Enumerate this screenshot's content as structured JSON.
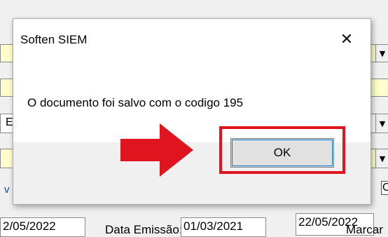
{
  "dialog": {
    "title": "Soften SIEM",
    "close_glyph": "✕",
    "message": "O documento foi salvo com o codigo 195",
    "ok_label": "OK"
  },
  "background": {
    "date_left": "2/05/2022",
    "date_emissao_label": "Data Emissão:",
    "date_emissao_value": "01/03/2021",
    "date_right": "22/05/2022",
    "marcar_label": "Marcar",
    "fragment_e": "E",
    "fragment_v": "v",
    "fragment_o": "O"
  },
  "annotation": {
    "arrow_color": "#e0141e",
    "highlight_color": "#e0141e"
  }
}
